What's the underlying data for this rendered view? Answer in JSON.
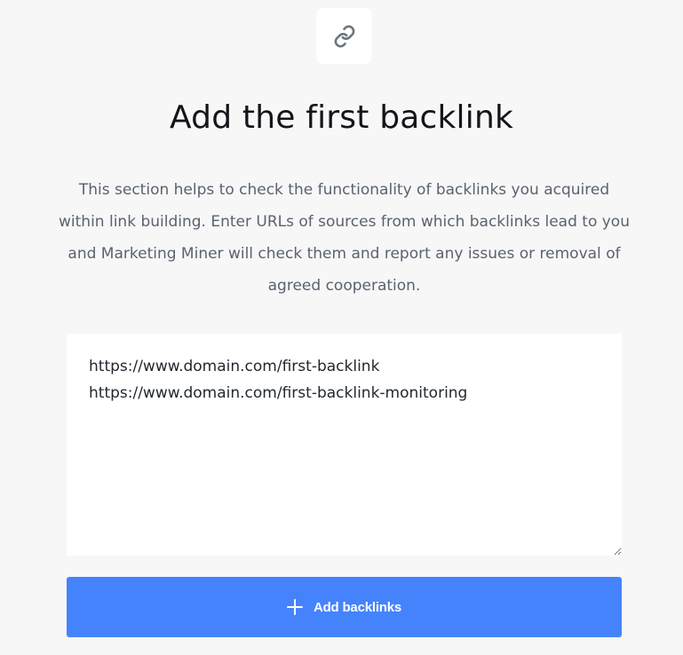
{
  "header": {
    "icon": "link-icon",
    "title": "Add the first backlink",
    "description": "This section helps to check the functionality of backlinks you acquired within link building. Enter URLs of sources from which backlinks lead to you and Marketing Miner will check them and report any issues or removal of agreed cooperation."
  },
  "backlinks_input": {
    "value": "https://www.domain.com/first-backlink\nhttps://www.domain.com/first-backlink-monitoring"
  },
  "actions": {
    "add_label": "Add backlinks",
    "add_icon": "plus-icon"
  },
  "colors": {
    "background": "#f7f7f7",
    "primary_button": "#4583fd",
    "icon": "#6b7580"
  }
}
